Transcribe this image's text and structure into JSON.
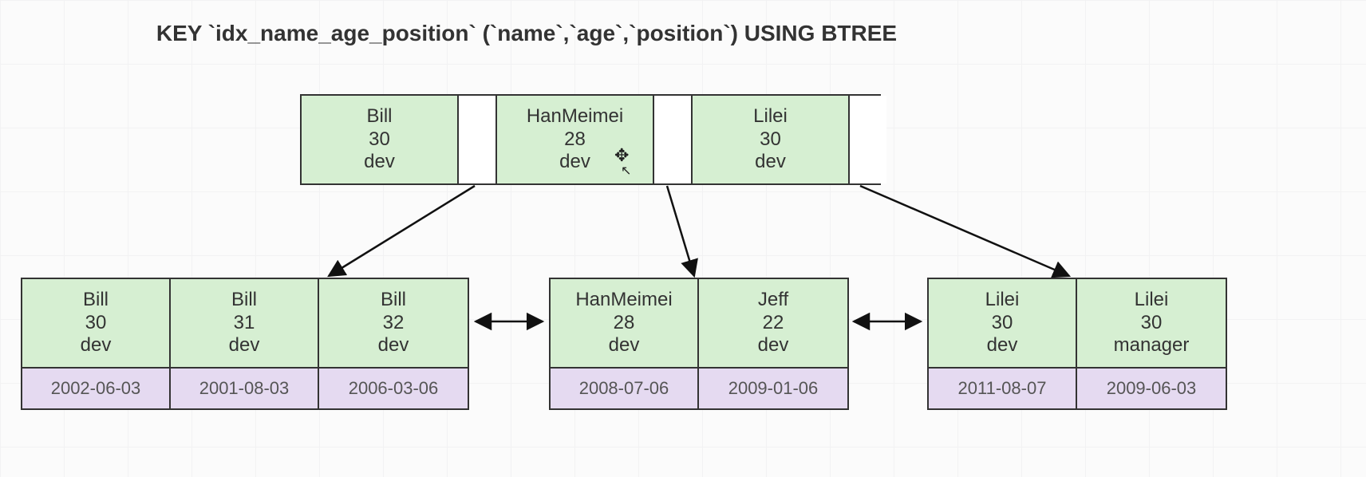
{
  "title": "KEY `idx_name_age_position` (`name`,`age`,`position`) USING BTREE",
  "colors": {
    "key_bg": "#d6efd2",
    "date_bg": "#e5daf1",
    "border": "#333333"
  },
  "root": {
    "keys": [
      {
        "name": "Bill",
        "age": "30",
        "position": "dev"
      },
      {
        "name": "HanMeimei",
        "age": "28",
        "position": "dev"
      },
      {
        "name": "Lilei",
        "age": "30",
        "position": "dev"
      }
    ]
  },
  "leaves": [
    {
      "entries": [
        {
          "name": "Bill",
          "age": "30",
          "position": "dev",
          "date": "2002-06-03"
        },
        {
          "name": "Bill",
          "age": "31",
          "position": "dev",
          "date": "2001-08-03"
        },
        {
          "name": "Bill",
          "age": "32",
          "position": "dev",
          "date": "2006-03-06"
        }
      ]
    },
    {
      "entries": [
        {
          "name": "HanMeimei",
          "age": "28",
          "position": "dev",
          "date": "2008-07-06"
        },
        {
          "name": "Jeff",
          "age": "22",
          "position": "dev",
          "date": "2009-01-06"
        }
      ]
    },
    {
      "entries": [
        {
          "name": "Lilei",
          "age": "30",
          "position": "dev",
          "date": "2011-08-07"
        },
        {
          "name": "Lilei",
          "age": "30",
          "position": "manager",
          "date": "2009-06-03"
        }
      ]
    }
  ],
  "cursor": {
    "glyph_top": "✥",
    "glyph_bottom": "↖"
  }
}
